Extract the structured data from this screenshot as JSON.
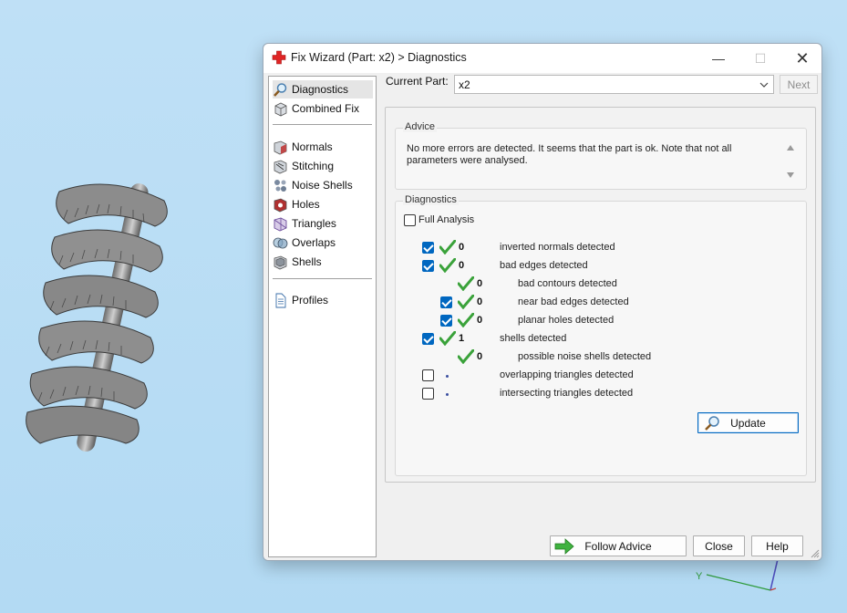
{
  "window": {
    "title": "Fix Wizard (Part: x2) > Diagnostics",
    "minimize_symbol": "—",
    "maximize_symbol": "☐",
    "close_symbol": "✕"
  },
  "nav": {
    "group1": [
      {
        "label": "Diagnostics",
        "icon": "magnifier-icon",
        "selected": true
      },
      {
        "label": "Combined Fix",
        "icon": "cube-icon"
      }
    ],
    "group2": [
      {
        "label": "Normals",
        "icon": "normals-icon"
      },
      {
        "label": "Stitching",
        "icon": "stitching-icon"
      },
      {
        "label": "Noise Shells",
        "icon": "noise-shells-icon"
      },
      {
        "label": "Holes",
        "icon": "holes-icon"
      },
      {
        "label": "Triangles",
        "icon": "triangles-icon"
      },
      {
        "label": "Overlaps",
        "icon": "overlaps-icon"
      },
      {
        "label": "Shells",
        "icon": "shells-icon"
      }
    ],
    "group3": [
      {
        "label": "Profiles",
        "icon": "document-icon"
      }
    ]
  },
  "header": {
    "current_part_label": "Current Part:",
    "current_part_value": "x2",
    "next_label": "Next"
  },
  "advice": {
    "title": "Advice",
    "text": "No more errors are detected. It seems that the part is ok. Note that not all parameters were analysed."
  },
  "diagnostics": {
    "title": "Diagnostics",
    "full_analysis_label": "Full Analysis",
    "full_analysis_checked": false,
    "rows": [
      {
        "checkbox": true,
        "checked": true,
        "status": "ok",
        "count": "0",
        "label": "inverted normals detected",
        "indent": 0
      },
      {
        "checkbox": true,
        "checked": true,
        "status": "ok",
        "count": "0",
        "label": "bad edges detected",
        "indent": 0
      },
      {
        "checkbox": false,
        "checked": false,
        "status": "ok",
        "count": "0",
        "label": "bad contours detected",
        "indent": 1
      },
      {
        "checkbox": true,
        "checked": true,
        "status": "ok",
        "count": "0",
        "label": "near bad edges detected",
        "indent": 1
      },
      {
        "checkbox": true,
        "checked": true,
        "status": "ok",
        "count": "0",
        "label": "planar holes detected",
        "indent": 1
      },
      {
        "checkbox": true,
        "checked": true,
        "status": "ok",
        "count": "1",
        "label": "shells detected",
        "indent": 0
      },
      {
        "checkbox": false,
        "checked": false,
        "status": "ok",
        "count": "0",
        "label": "possible noise shells detected",
        "indent": 1
      },
      {
        "checkbox": true,
        "checked": false,
        "status": "none",
        "count": "",
        "label": "overlapping triangles detected",
        "indent": 0
      },
      {
        "checkbox": true,
        "checked": false,
        "status": "none",
        "count": "",
        "label": "intersecting triangles detected",
        "indent": 0
      }
    ],
    "update_label": "Update"
  },
  "footer": {
    "follow_advice_label": "Follow Advice",
    "close_label": "Close",
    "help_label": "Help"
  },
  "viewport": {
    "axis_label": "Y"
  },
  "colors": {
    "accent": "#0067c0",
    "ok_green": "#3aa23a",
    "desktop": "#b8dcf4"
  }
}
